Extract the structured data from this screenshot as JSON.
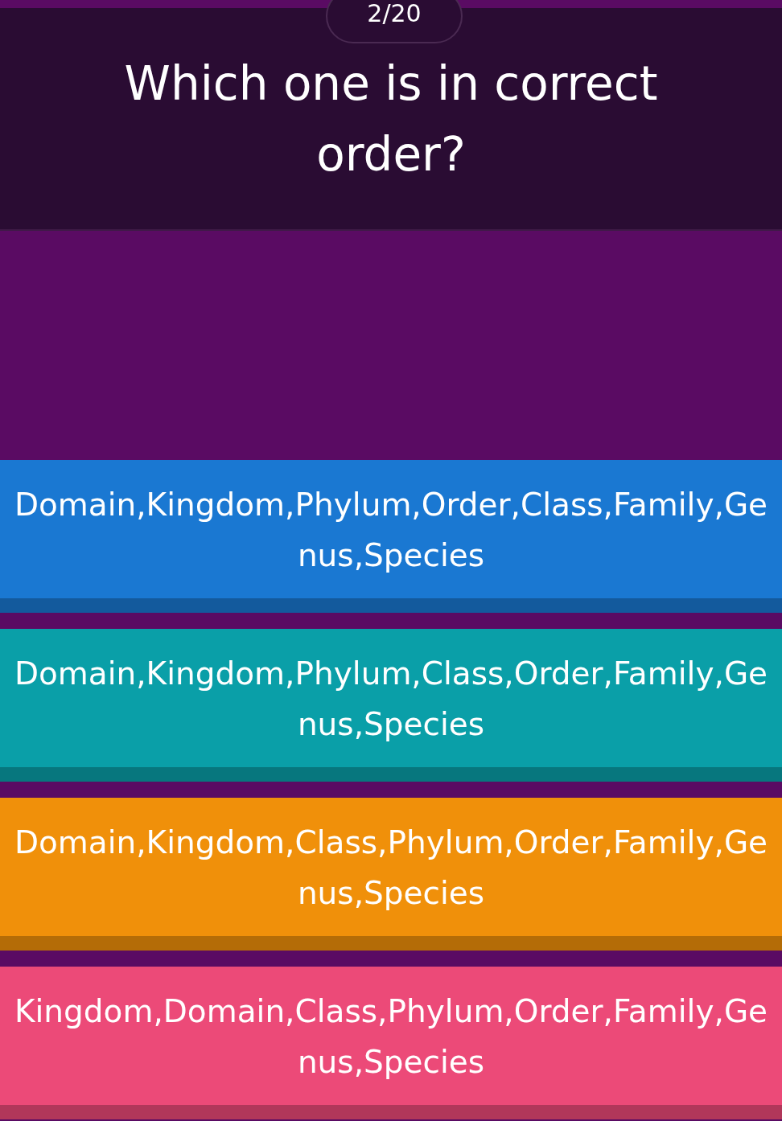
{
  "counter": "2/20",
  "question": "Which one is in correct order?",
  "options": [
    {
      "text": "Domain,Kingdom,Phylum,Order,Class,Family,Genus,Species",
      "color": "#1a78d2"
    },
    {
      "text": "Domain,Kingdom,Phylum,Class,Order,Family,Genus,Species",
      "color": "#0a9fa8"
    },
    {
      "text": "Domain,Kingdom,Class,Phylum,Order,Family,Genus,Species",
      "color": "#f0900a"
    },
    {
      "text": "Kingdom,Domain,Class,Phylum,Order,Family,Genus,Species",
      "color": "#ec4a78"
    }
  ]
}
